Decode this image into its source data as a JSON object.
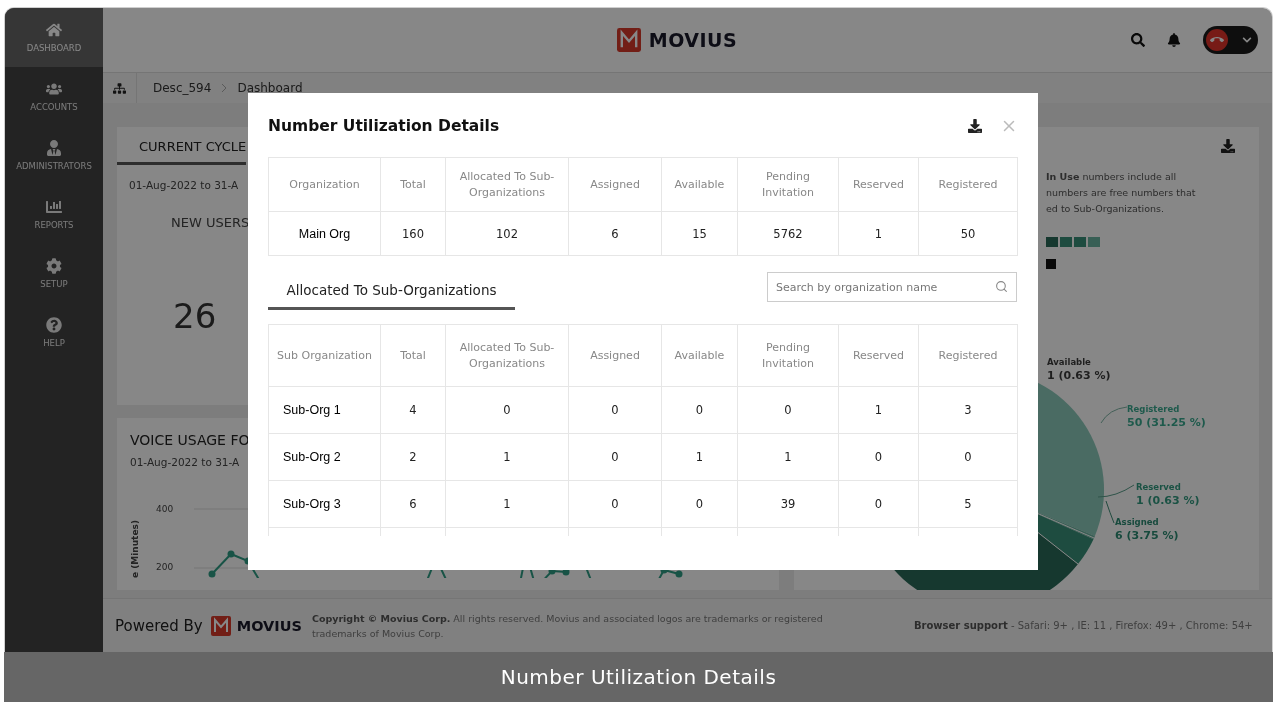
{
  "sidebar": {
    "items": [
      {
        "kind": "home",
        "label": "DASHBOARD",
        "selected": true
      },
      {
        "kind": "users",
        "label": "ACCOUNTS",
        "selected": false
      },
      {
        "kind": "admin",
        "label": "ADMINISTRATORS",
        "selected": false
      },
      {
        "kind": "reports",
        "label": "REPORTS",
        "selected": false
      },
      {
        "kind": "setup",
        "label": "SETUP",
        "selected": false
      },
      {
        "kind": "help",
        "label": "HELP",
        "selected": false
      }
    ]
  },
  "header": {
    "logo": "MOVIUS"
  },
  "breadcrumb": [
    "Desc_594",
    "Dashboard"
  ],
  "cycle_card": {
    "title": "CURRENT CYCLE",
    "date_range": "01-Aug-2022 to 31-A",
    "metric_label": "NEW USERS",
    "metric_value": "26"
  },
  "voice_card": {
    "title": "VOICE USAGE FO",
    "date_range": "01-Aug-2022 to 31-A",
    "y_label": "e (Minutes)",
    "y_ticks": [
      "400",
      "200"
    ]
  },
  "numbers_card": {
    "note_lines": [
      "**In Use** numbers include all",
      "numbers are free numbers that",
      "ed to Sub-Organizations."
    ],
    "pie_labels": [
      {
        "name": "Available",
        "value": "1 (0.63 %)",
        "color": "#1f1f1f"
      },
      {
        "name": "Registered",
        "value": "50 (31.25 %)",
        "color": "#1e5a4c"
      },
      {
        "name": "Reserved",
        "value": "1 (0.63 %)",
        "color": "#1a5244"
      },
      {
        "name": "Assigned",
        "value": "6 (3.75 %)",
        "color": "#174a3d"
      }
    ]
  },
  "footer": {
    "powered_by": "Powered By",
    "logo": "MOVIUS",
    "copyright": "**Copyright © Movius Corp.** All rights reserved. Movius and associated logos are trademarks or registered trademarks of Movius Corp.",
    "browser_support": "**Browser support** - Safari: 9+ , IE: 11 , Firefox: 49+ , Chrome: 54+"
  },
  "modal": {
    "title": "Number Utilization Details",
    "columns": [
      "Organization",
      "Total",
      "Allocated To Sub-Organizations",
      "Assigned",
      "Available",
      "Pending Invitation",
      "Reserved",
      "Registered"
    ],
    "org_row": [
      "Main Org",
      "160",
      "102",
      "6",
      "15",
      "5762",
      "1",
      "50"
    ],
    "tab": {
      "label": "Allocated To Sub-Organizations",
      "selected": true
    },
    "search": {
      "placeholder": "Search by organization name"
    },
    "sub_columns": [
      "Sub Organization",
      "Total",
      "Allocated To Sub-Organizations",
      "Assigned",
      "Available",
      "Pending Invitation",
      "Reserved",
      "Registered"
    ],
    "sub_rows": [
      [
        "Sub-Org 1",
        "4",
        "0",
        "0",
        "0",
        "0",
        "1",
        "3"
      ],
      [
        "Sub-Org 2",
        "2",
        "1",
        "0",
        "1",
        "1",
        "0",
        "0"
      ],
      [
        "Sub-Org 3",
        "6",
        "1",
        "0",
        "0",
        "39",
        "0",
        "5"
      ]
    ]
  },
  "caption": "Number Utilization Details"
}
